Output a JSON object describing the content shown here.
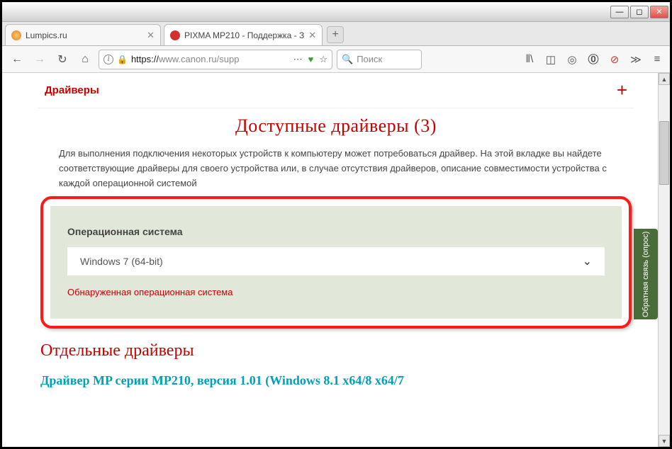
{
  "tabs": [
    {
      "title": "Lumpics.ru",
      "favcolor": "#f39c12"
    },
    {
      "title": "PIXMA MP210 - Поддержка - З",
      "favcolor": "#d32f2f"
    }
  ],
  "url": {
    "prefix": "https://",
    "host": "www.canon.ru",
    "path": "/supp"
  },
  "search": {
    "placeholder": "Поиск"
  },
  "page": {
    "drivers_tab": "Драйверы",
    "available_title": "Доступные драйверы (3)",
    "description": "Для выполнения подключения некоторых устройств к компьютеру может потребоваться драйвер. На этой вкладке вы найдете соответствующие драйверы для своего устройства или, в случае отсутствия драйверов, описание совместимости устройства с каждой операционной системой",
    "os_label": "Операционная система",
    "os_value": "Windows 7 (64-bit)",
    "detected_text": "Обнаруженная операционная система",
    "separate_title": "Отдельные драйверы",
    "driver_link": "Драйвер MP серии MP210, версия 1.01 (Windows 8.1 x64/8 x64/7"
  },
  "feedback": "Обратная связь\n(опрос)"
}
